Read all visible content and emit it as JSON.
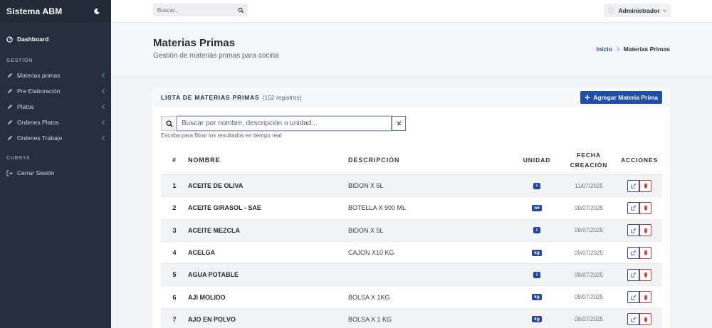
{
  "sidebar": {
    "brand": "Sistema ABM",
    "dashboard": "Dashboard",
    "section_gestion": "GESTIÓN",
    "items": [
      {
        "label": "Materias primas"
      },
      {
        "label": "Pre Elaboración"
      },
      {
        "label": "Platos"
      },
      {
        "label": "Ordenes Platos"
      },
      {
        "label": "Ordenes Trabajo"
      }
    ],
    "section_cuenta": "CUENTA",
    "logout": "Cerrar Sesión"
  },
  "topbar": {
    "search_placeholder": "Buscar..",
    "user": "Administrador"
  },
  "page": {
    "title": "Materias Primas",
    "subtitle": "Gestión de materias primas para cocina",
    "breadcrumb_home": "Inicio",
    "breadcrumb_current": "Materias Primas"
  },
  "card": {
    "title": "LISTA DE MATERIAS PRIMAS",
    "count": "(152 registros)",
    "add_label": "Agregar Materia Prima",
    "filter_placeholder": "Buscar por nombre, descripción o unidad...",
    "filter_hint": "Escriba para filtrar los resultados en tiempo real"
  },
  "table": {
    "headers": {
      "num": "#",
      "name": "NOMBRE",
      "desc": "DESCRIPCIÓN",
      "unit": "UNIDAD",
      "date_line1": "FECHA",
      "date_line2": "CREACIÓN",
      "actions": "ACCIONES"
    },
    "rows": [
      {
        "num": "1",
        "name": "ACEITE DE OLIVA",
        "desc": "BIDON X 5L",
        "unit": "l",
        "date": "11/07/2025"
      },
      {
        "num": "2",
        "name": "ACEITE GIRASOL - SAE",
        "desc": "BOTELLA X 900 ML",
        "unit": "ml",
        "date": "09/07/2025"
      },
      {
        "num": "3",
        "name": "ACEITE MEZCLA",
        "desc": "BIDON X 5L",
        "unit": "l",
        "date": "09/07/2025"
      },
      {
        "num": "4",
        "name": "ACELGA",
        "desc": "CAJON X10 KG",
        "unit": "kg",
        "date": "09/07/2025"
      },
      {
        "num": "5",
        "name": "AGUA POTABLE",
        "desc": "",
        "unit": "l",
        "date": "09/07/2025"
      },
      {
        "num": "6",
        "name": "AJI MOLIDO",
        "desc": "BOLSA X 1KG",
        "unit": "kg",
        "date": "09/07/2025"
      },
      {
        "num": "7",
        "name": "AJO EN POLVO",
        "desc": "BOLSA X 1 KG",
        "unit": "kg",
        "date": "09/07/2025"
      }
    ]
  },
  "colors": {
    "sidebar": "#262f3d",
    "primary": "#1f4fa8",
    "danger": "#c23a3a"
  }
}
